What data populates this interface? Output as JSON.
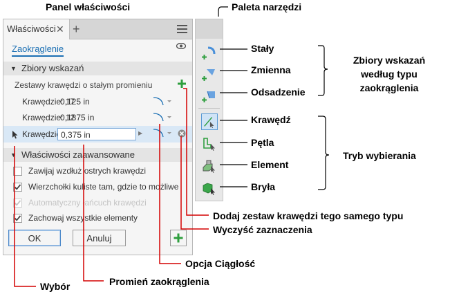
{
  "callouts": {
    "panel_title": "Panel właściwości",
    "palette_title": "Paleta narzędzi",
    "staly": "Stały",
    "zmienna": "Zmienna",
    "odsadzenie": "Odsadzenie",
    "zbiory_group": "Zbiory wskazań według typu zaokrąglenia",
    "krawedz": "Krawędź",
    "petla": "Pętla",
    "element": "Element",
    "bryla": "Bryła",
    "tryb_group": "Tryb wybierania",
    "dodaj": "Dodaj zestaw krawędzi tego samego typu",
    "wyczysc": "Wyczyść zaznaczenia",
    "opcja": "Opcja Ciągłość",
    "promien": "Promień zaokrąglenia",
    "wybor": "Wybór"
  },
  "panel": {
    "tab_label": "Właściwości",
    "tab_close": "✕",
    "tab_add": "+",
    "feature_link": "Zaokrąglenie",
    "section1": "Zbiory wskazań",
    "subhead": "Zestawy krawędzi o stałym promieniu",
    "rows": [
      {
        "label": "Krawędzie: 17",
        "value": "0,125 in"
      },
      {
        "label": "Krawędzie: 12",
        "value": "0,1875 in"
      },
      {
        "label": "Krawędzie: 4",
        "value": "0,375 in"
      }
    ],
    "section2": "Właściwości zaawansowane",
    "options": [
      {
        "label": "Zawijaj wzdłuż ostrych krawędzi",
        "checked": false,
        "disabled": false
      },
      {
        "label": "Wierzchołki kuliste tam, gdzie to możliwe",
        "checked": true,
        "disabled": false
      },
      {
        "label": "Automatyczny łańcuch krawędzi",
        "checked": true,
        "disabled": true
      },
      {
        "label": "Zachowaj wszystkie elementy",
        "checked": true,
        "disabled": false
      }
    ],
    "ok_label": "OK",
    "cancel_label": "Anuluj"
  },
  "colors": {
    "accent": "#1b6fb3",
    "green": "#2e9e3e",
    "red": "#d40000",
    "selection": "#d9e8f6"
  }
}
